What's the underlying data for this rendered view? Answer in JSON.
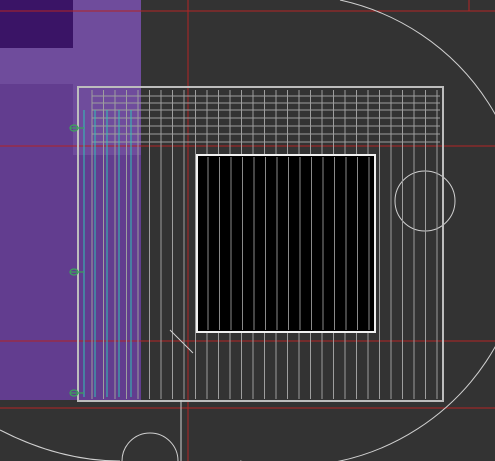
{
  "viewport": {
    "name": "cad-viewport",
    "background": "#333333"
  },
  "colors": {
    "selection_fill": "#6b3fa0",
    "selection_dark": "#3a1466",
    "selection_overlay": "#7a5aa8",
    "frame_line": "#bdbdbd",
    "grid_line": "#9e9e9e",
    "guide_red": "#b32424",
    "arc_line": "#d0d0d0",
    "panel_fill": "#000000",
    "panel_stroke": "#f0f0f0",
    "cyan_line": "#2ec4b6",
    "green_marker": "#3aa55a"
  },
  "icons": [
    "selection-rect",
    "axis-marker",
    "arc",
    "circle-hole"
  ]
}
